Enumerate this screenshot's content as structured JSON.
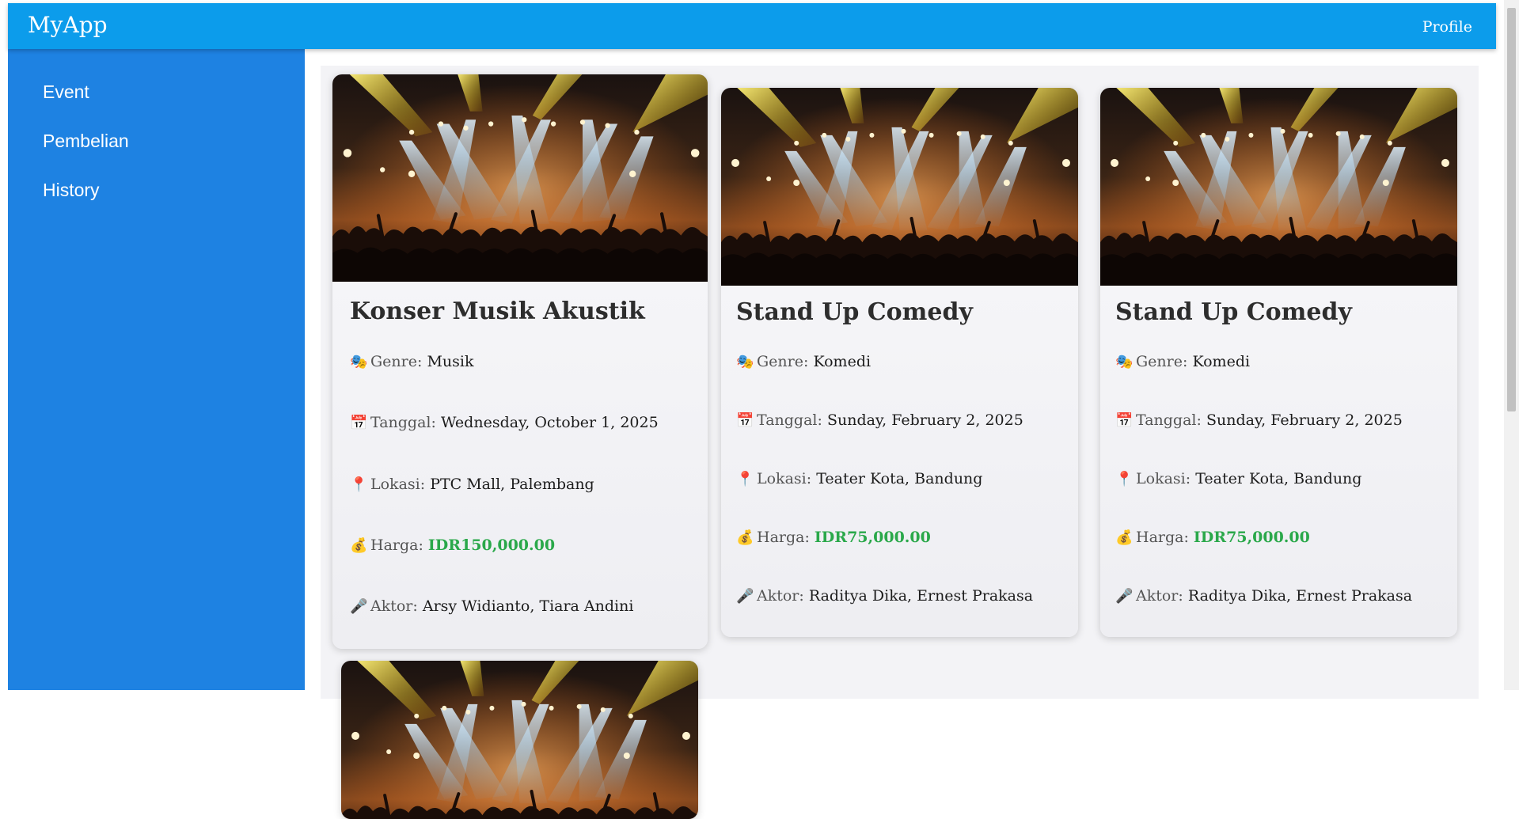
{
  "header": {
    "brand": "MyApp",
    "profile_label": "Profile"
  },
  "sidebar": {
    "items": [
      {
        "label": "Event"
      },
      {
        "label": "Pembelian"
      },
      {
        "label": "History"
      }
    ]
  },
  "labels": {
    "genre": "Genre:",
    "date": "Tanggal:",
    "location": "Lokasi:",
    "price": "Harga:",
    "actor": "Aktor:"
  },
  "icons": {
    "genre": "🎭",
    "date": "📅",
    "location": "📍",
    "price": "💰",
    "actor": "🎤"
  },
  "events": [
    {
      "title": "Konser Musik Akustik",
      "genre": "Musik",
      "date": "Wednesday, October 1, 2025",
      "location": "PTC Mall, Palembang",
      "price": "IDR150,000.00",
      "actors": "Arsy Widianto, Tiara Andini"
    },
    {
      "title": "Stand Up Comedy",
      "genre": "Komedi",
      "date": "Sunday, February 2, 2025",
      "location": "Teater Kota, Bandung",
      "price": "IDR75,000.00",
      "actors": "Raditya Dika, Ernest Prakasa"
    },
    {
      "title": "Stand Up Comedy",
      "genre": "Komedi",
      "date": "Sunday, February 2, 2025",
      "location": "Teater Kota, Bandung",
      "price": "IDR75,000.00",
      "actors": "Raditya Dika, Ernest Prakasa"
    }
  ],
  "colors": {
    "topbar": "#0c9ceb",
    "sidebar": "#1e82e2",
    "price": "#2aa84a"
  }
}
